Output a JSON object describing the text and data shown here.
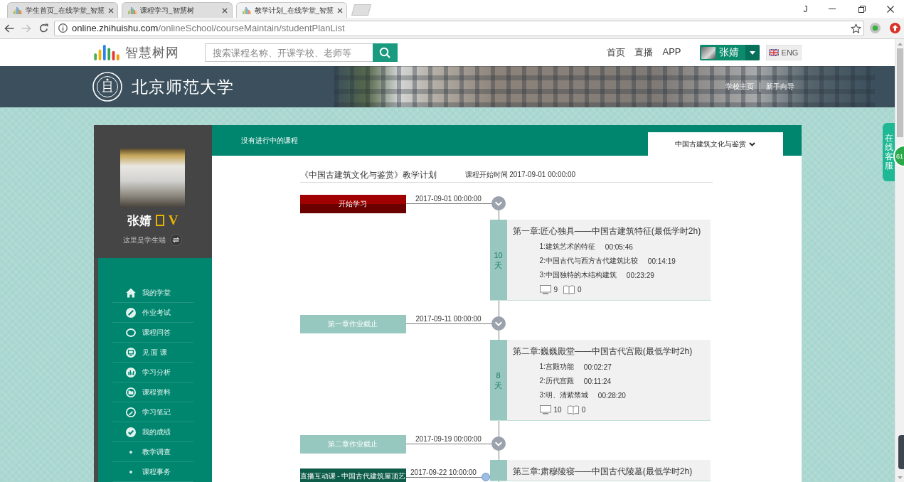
{
  "browser": {
    "tabs": [
      {
        "title": "学生首页_在线学堂_智慧",
        "selected": false
      },
      {
        "title": "课程学习_智慧树",
        "selected": false
      },
      {
        "title": "教学计划_在线学堂_智慧",
        "selected": true
      }
    ],
    "profile": "J",
    "navigation": {
      "back": {
        "disabled": false
      },
      "forward": {
        "disabled": true
      }
    },
    "address": {
      "host": "online.zhihuishu.com",
      "path": "/onlineSchool/courseMaintain/studentPlanList"
    }
  },
  "header": {
    "logo": "智慧树网",
    "search": {
      "placeholder": "搜索课程名称、开课学校、老师等"
    },
    "links": [
      "首页",
      "直播",
      "APP"
    ],
    "user": "张婧",
    "language": "ENG"
  },
  "banner": {
    "school": "北京师范大学",
    "links": [
      "学校主页",
      "新手向导"
    ]
  },
  "sidebar": {
    "name": "张婧",
    "vip": "V",
    "role": "这里是学生端",
    "items": [
      {
        "label": "我的学堂",
        "kind": "home"
      },
      {
        "label": "作业考试",
        "kind": "exam"
      },
      {
        "label": "课程问答",
        "kind": "chat"
      },
      {
        "label": "见 面 课",
        "kind": "meeting"
      },
      {
        "label": "学习分析",
        "kind": "chart"
      },
      {
        "label": "课程资料",
        "kind": "folder"
      },
      {
        "label": "学习笔记",
        "kind": "note"
      },
      {
        "label": "我的成绩",
        "kind": "grade"
      },
      {
        "label": "教学调查",
        "kind": "bullet"
      },
      {
        "label": "课程事务",
        "kind": "bullet"
      }
    ]
  },
  "course_bar": {
    "status": "没有进行中的课程",
    "course": "中国古建筑文化与鉴赏"
  },
  "plan": {
    "title": "《中国古建筑文化与鉴赏》教学计划",
    "start_time": "课程开始时间 2017-09-01 00:00:00",
    "timeline": [
      {
        "kind": "start",
        "label": "开始学习",
        "date": "2017-09-01 00:00:00"
      },
      {
        "kind": "chapter",
        "days": "10 天",
        "title": "第一章:匠心独具——中国古建筑特征(最低学时2h)",
        "lessons": [
          {
            "name": "1:建筑艺术的特征",
            "duration": "00:05:46"
          },
          {
            "name": "2:中国古代与西方古代建筑比较",
            "duration": "00:14:19"
          },
          {
            "name": "3:中国独特的木结构建筑",
            "duration": "00:23:29"
          }
        ],
        "videos": "9",
        "documents": "0"
      },
      {
        "kind": "deadline",
        "label": "第一章作业截止",
        "date": "2017-09-11 00:00:00"
      },
      {
        "kind": "chapter",
        "days": "8 天",
        "title": "第二章:巍巍殿堂——中国古代宫殿(最低学时2h)",
        "lessons": [
          {
            "name": "1:宫殿功能",
            "duration": "00:02:27"
          },
          {
            "name": "2:历代宫殿",
            "duration": "00:11:24"
          },
          {
            "name": "3:明、清紫禁城",
            "duration": "00:28:20"
          }
        ],
        "videos": "10",
        "documents": "0"
      },
      {
        "kind": "deadline",
        "label": "第二章作业截止",
        "date": "2017-09-19 00:00:00"
      },
      {
        "kind": "live",
        "label": "直播互动课 - 中国古代建筑屋顶艺",
        "date": "2017-09-22 10:00:00"
      },
      {
        "kind": "chapter",
        "title": "第三章:肃穆陵寝——中国古代陵墓(最低学时2h)"
      }
    ]
  },
  "service": {
    "label": "在线客服",
    "badge": "61"
  }
}
